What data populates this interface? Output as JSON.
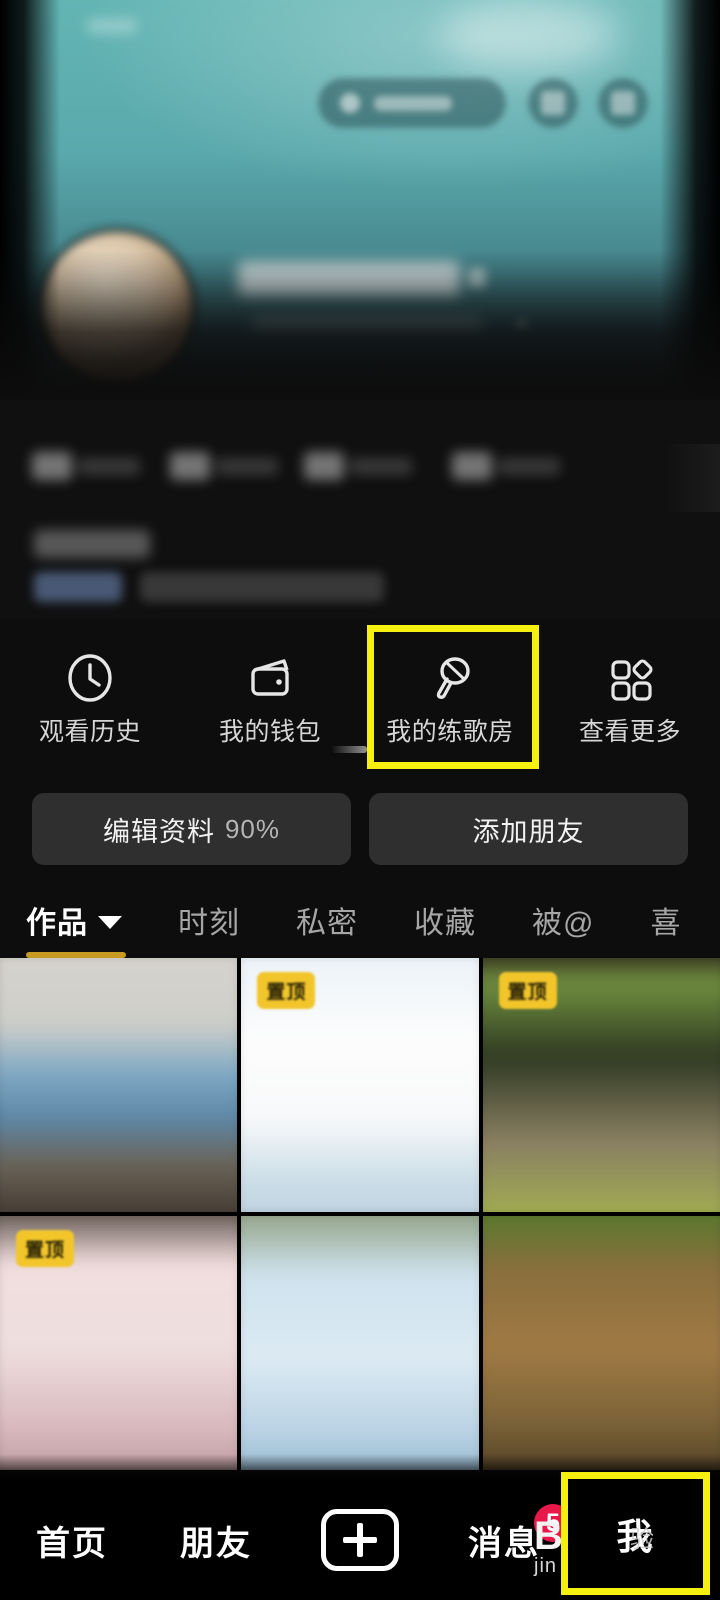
{
  "app": {
    "platform": "douyin-profile"
  },
  "cover": {
    "username_redacted": true,
    "avatar_name": "user-avatar",
    "accent_teal": "#5aa9ac"
  },
  "quick_actions": [
    {
      "label": "观看历史",
      "icon": "clock-icon",
      "name": "watch-history"
    },
    {
      "label": "我的钱包",
      "icon": "wallet-icon",
      "name": "my-wallet"
    },
    {
      "label": "我的练歌房",
      "icon": "microphone-icon",
      "name": "my-karaoke-room",
      "highlighted": true
    },
    {
      "label": "查看更多",
      "icon": "grid-more-icon",
      "name": "view-more"
    }
  ],
  "actions": {
    "edit_profile_label": "编辑资料",
    "edit_profile_percent": "90%",
    "add_friend_label": "添加朋友"
  },
  "tabs": [
    {
      "label": "作品",
      "active": true,
      "has_chevron": true
    },
    {
      "label": "时刻",
      "active": false
    },
    {
      "label": "私密",
      "active": false
    },
    {
      "label": "收藏",
      "active": false
    },
    {
      "label": "被@",
      "active": false
    },
    {
      "label": "喜",
      "active": false
    }
  ],
  "grid": [
    {
      "badge": "",
      "name": "post-thumb-1"
    },
    {
      "badge": "置顶",
      "name": "post-thumb-2"
    },
    {
      "badge": "置顶",
      "name": "post-thumb-3"
    },
    {
      "badge": "置顶",
      "name": "post-thumb-4"
    },
    {
      "badge": "",
      "name": "post-thumb-5"
    },
    {
      "badge": "",
      "name": "post-thumb-6"
    }
  ],
  "bottom_nav": [
    {
      "label": "首页",
      "name": "home"
    },
    {
      "label": "朋友",
      "name": "friends"
    },
    {
      "label": "",
      "name": "create",
      "icon": "plus-icon"
    },
    {
      "label": "消息",
      "name": "messages",
      "badge": "5"
    },
    {
      "label": "我",
      "name": "profile",
      "highlighted": true
    }
  ],
  "watermark": {
    "big": "B",
    "small": "jin"
  },
  "highlight": {
    "color": "#f5f010"
  }
}
